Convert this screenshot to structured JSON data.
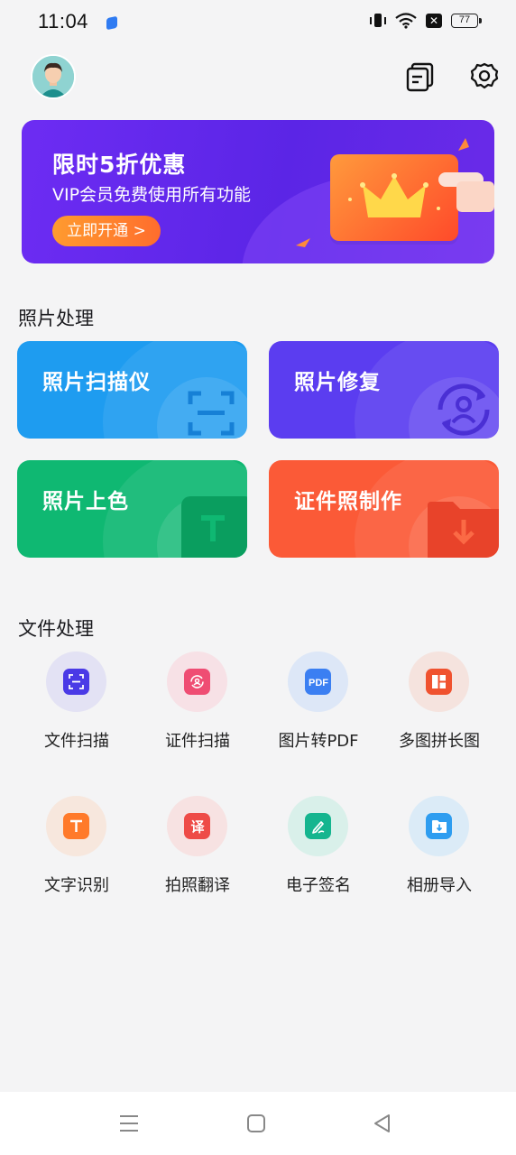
{
  "status_bar": {
    "time": "11:04",
    "battery": "77"
  },
  "header": {
    "avatar": "user-avatar",
    "icons": [
      "documents-icon",
      "gear-icon"
    ]
  },
  "banner": {
    "title": "限时5折优惠",
    "subtitle": "VIP会员免费使用所有功能",
    "button_label": "立即开通 >"
  },
  "photo_section": {
    "title": "照片处理",
    "tiles": [
      {
        "label": "照片扫描仪",
        "color": "#1e9cf0",
        "icon": "scan-icon"
      },
      {
        "label": "照片修复",
        "color": "#5b3df0",
        "icon": "portrait-restore-icon"
      },
      {
        "label": "照片上色",
        "color": "#0fb872",
        "icon": "text-t-icon"
      },
      {
        "label": "证件照制作",
        "color": "#fb5a37",
        "icon": "folder-download-icon"
      }
    ]
  },
  "file_section": {
    "title": "文件处理",
    "tools": [
      {
        "label": "文件扫描",
        "icon": "document-scan-icon",
        "color": "#4a3ae6",
        "bg": "#e3e2f4"
      },
      {
        "label": "证件扫描",
        "icon": "id-scan-icon",
        "color": "#ef4d73",
        "bg": "#f7e1e6"
      },
      {
        "label": "图片转PDF",
        "icon": "pdf-icon",
        "color": "#3b7ff2",
        "bg": "#dde7f7"
      },
      {
        "label": "多图拼长图",
        "icon": "collage-icon",
        "color": "#f0522f",
        "bg": "#f5e3de"
      },
      {
        "label": "文字识别",
        "icon": "text-recognition-icon",
        "color": "#ff7a2a",
        "bg": "#f7e7dd"
      },
      {
        "label": "拍照翻译",
        "icon": "translate-icon",
        "color": "#ee4b47",
        "bg": "#f7e2e2"
      },
      {
        "label": "电子签名",
        "icon": "signature-icon",
        "color": "#15b58f",
        "bg": "#d9f0ea"
      },
      {
        "label": "相册导入",
        "icon": "album-import-icon",
        "color": "#2e9df0",
        "bg": "#dbebf7"
      }
    ]
  },
  "nav": {
    "items": [
      "menu-icon",
      "home-icon",
      "back-icon"
    ]
  }
}
